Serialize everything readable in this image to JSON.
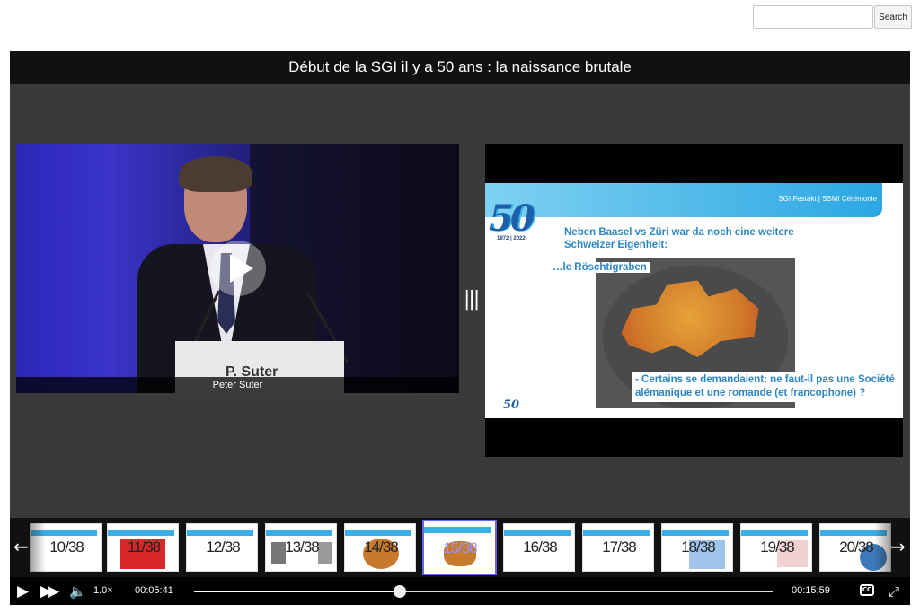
{
  "search": {
    "placeholder": "",
    "value": "",
    "button_label": "Search"
  },
  "player": {
    "title": "Début de la SGI il y a 50 ans : la naissance brutale",
    "video": {
      "caption": "Peter Suter",
      "podium_text": "P. Suter"
    },
    "slide": {
      "header": "SGI Festakt | SSMI Cérémonie",
      "logo_number": "50",
      "logo_years": "1972 | 2022",
      "line1": "Neben Baasel vs Züri war da noch eine weitere Schweizer Eigenheit:",
      "line2": "…le Röschtigraben",
      "line3": "- Certains se demandaient: ne faut-il pas une Société alémanique et une romande (et francophone) ?",
      "footer_logo": "50"
    },
    "thumbnails": [
      {
        "label": "10/38",
        "active": false
      },
      {
        "label": "11/38",
        "active": false
      },
      {
        "label": "12/38",
        "active": false
      },
      {
        "label": "13/38",
        "active": false
      },
      {
        "label": "14/38",
        "active": false
      },
      {
        "label": "15/38",
        "active": true
      },
      {
        "label": "16/38",
        "active": false
      },
      {
        "label": "17/38",
        "active": false
      },
      {
        "label": "18/38",
        "active": false
      },
      {
        "label": "19/38",
        "active": false
      },
      {
        "label": "20/38",
        "active": false
      }
    ],
    "controls": {
      "speed": "1.0×",
      "current_time": "00:05:41",
      "total_time": "00:15:59",
      "progress": 0.356,
      "cc_label": "CC"
    }
  },
  "colors": {
    "accent": "#6b61f0",
    "slide_blue": "#2a86c6",
    "header_blue": "#2ba7e3"
  }
}
